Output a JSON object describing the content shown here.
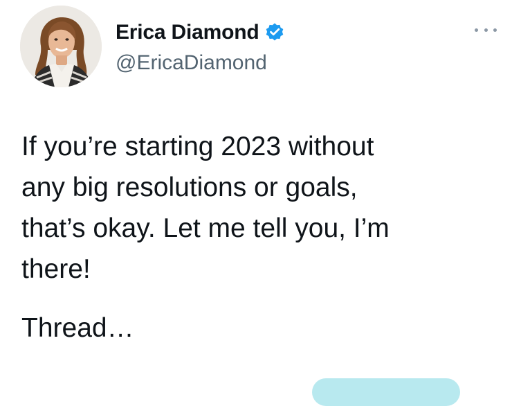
{
  "tweet": {
    "author": {
      "display_name": "Erica Diamond",
      "handle": "@EricaDiamond",
      "verified_icon": "verified-badge-icon",
      "avatar_icon": "profile-photo"
    },
    "more_icon": "more-options-icon",
    "text_lines": [
      "If you’re starting 2023 without",
      "any big resolutions or goals,",
      "that’s okay. Let me tell you, I’m",
      "there!"
    ],
    "thread_label": "Thread…",
    "accent_color": "#1d9bf0",
    "secondary_text_color": "#536471",
    "pill_color": "#b8e9ef"
  }
}
